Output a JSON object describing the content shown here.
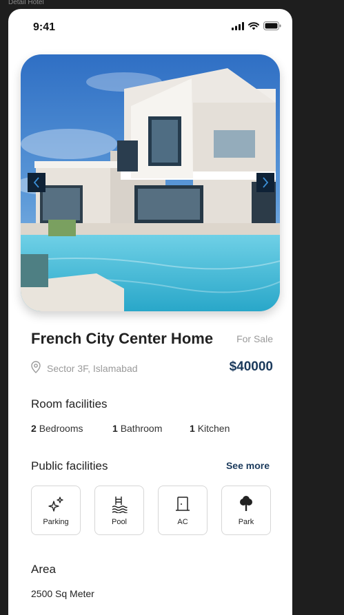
{
  "frame_label": "Detail Hotel",
  "status_bar": {
    "time": "9:41"
  },
  "property": {
    "title": "French City Center Home",
    "status": "For Sale",
    "location": "Sector 3F, Islamabad",
    "price": "$40000"
  },
  "room_facilities": {
    "title": "Room facilities",
    "items": [
      {
        "count": "2",
        "label": "Bedrooms"
      },
      {
        "count": "1",
        "label": "Bathroom"
      },
      {
        "count": "1",
        "label": "Kitchen"
      }
    ]
  },
  "public_facilities": {
    "title": "Public facilities",
    "see_more": "See more",
    "items": [
      {
        "label": "Parking",
        "icon": "sparkles-icon"
      },
      {
        "label": "Pool",
        "icon": "pool-icon"
      },
      {
        "label": "AC",
        "icon": "door-icon"
      },
      {
        "label": "Park",
        "icon": "tree-icon"
      }
    ]
  },
  "area": {
    "title": "Area",
    "value": "2500 Sq Meter"
  },
  "colors": {
    "accent": "#1b3a5c",
    "muted_text": "#9a9a9a",
    "carousel_button": "#0f2236"
  }
}
